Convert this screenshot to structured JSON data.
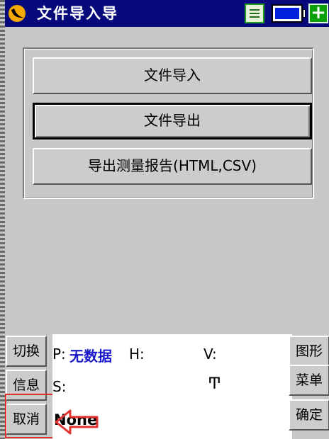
{
  "titlebar": {
    "title": "文件导入导"
  },
  "main": {
    "import_label": "文件导入",
    "export_label": "文件导出",
    "report_label": "导出测量报告(HTML,CSV)"
  },
  "left_buttons": {
    "switch_label": "切换",
    "info_label": "信息",
    "cancel_label": "取消"
  },
  "right_buttons": {
    "graph_label": "图形",
    "menu_label": "菜单",
    "ok_label": "确定"
  },
  "status": {
    "p_label": "P:",
    "p_value": "无数据",
    "h_label": "H:",
    "v_label": "V:",
    "s_label": "S:",
    "antenna_glyph": "Ͳ",
    "none_text": "None"
  },
  "colors": {
    "titlebar": "#07097b",
    "p_value": "#1a1acc",
    "highlight": "#e03030"
  }
}
